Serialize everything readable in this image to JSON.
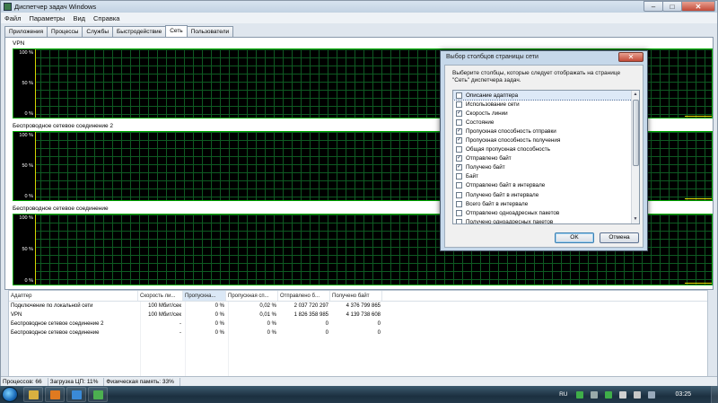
{
  "window": {
    "title": "Диспетчер задач Windows",
    "controls": {
      "minimize": "–",
      "maximize": "□",
      "close": "✕"
    }
  },
  "menu": [
    "Файл",
    "Параметры",
    "Вид",
    "Справка"
  ],
  "tabs": [
    "Приложения",
    "Процессы",
    "Службы",
    "Быстродействие",
    "Сеть",
    "Пользователи"
  ],
  "active_tab": "Сеть",
  "graphs": [
    {
      "label": "VPN",
      "y_top": "100 %",
      "y_mid": "50 %",
      "y_bottom": "0 %"
    },
    {
      "label": "Беспроводное сетевое соединение 2",
      "y_top": "100 %",
      "y_mid": "50 %",
      "y_bottom": "0 %"
    },
    {
      "label": "Беспроводное сетевое соединение",
      "y_top": "100 %",
      "y_mid": "50 %",
      "y_bottom": "0 %"
    }
  ],
  "adapter_table": {
    "columns": [
      "Адаптер",
      "Скорость ли...",
      "Пропускна...",
      "Пропускная сп...",
      "Отправлено б...",
      "Получено байт"
    ],
    "rows": [
      [
        "Подключение по локальной сети",
        "100 Мбит/сек",
        "0 %",
        "0,02 %",
        "2 037 720 297",
        "4 376 799 865"
      ],
      [
        "VPN",
        "100 Мбит/сек",
        "0 %",
        "0,01 %",
        "1 826 358 985",
        "4 139 738 608"
      ],
      [
        "Беспроводное сетевое соединение 2",
        "-",
        "0 %",
        "0 %",
        "0",
        "0"
      ],
      [
        "Беспроводное сетевое соединение",
        "-",
        "0 %",
        "0 %",
        "0",
        "0"
      ]
    ]
  },
  "statusbar": {
    "processes": "Процессов: 66",
    "cpu": "Загрузка ЦП: 11%",
    "memory": "Физическая память: 33%"
  },
  "dialog": {
    "title": "Выбор столбцов страницы сети",
    "close": "✕",
    "description": "Выберите столбцы, которые следует отображать на странице \"Сеть\" диспетчера задач.",
    "options": [
      {
        "label": "Описание адаптера",
        "checked": false,
        "selected": true
      },
      {
        "label": "Использование сети",
        "checked": false
      },
      {
        "label": "Скорость линии",
        "checked": true
      },
      {
        "label": "Состояние",
        "checked": false
      },
      {
        "label": "Пропускная способность отправки",
        "checked": true
      },
      {
        "label": "Пропускная способность получения",
        "checked": true
      },
      {
        "label": "Общая пропускная способность",
        "checked": false
      },
      {
        "label": "Отправлено байт",
        "checked": true
      },
      {
        "label": "Получено байт",
        "checked": true
      },
      {
        "label": "Байт",
        "checked": false
      },
      {
        "label": "Отправлено байт в интервале",
        "checked": false
      },
      {
        "label": "Получено байт в интервале",
        "checked": false
      },
      {
        "label": "Всего байт в интервале",
        "checked": false
      },
      {
        "label": "Отправлено одноадресных пакетов",
        "checked": false
      },
      {
        "label": "Получено одноадресных пакетов",
        "checked": false
      }
    ],
    "ok": "OK",
    "cancel": "Отмена"
  },
  "taskbar": {
    "apps": [
      {
        "name": "explorer-icon",
        "color": "#d8b040"
      },
      {
        "name": "media-player-icon",
        "color": "#e07a20"
      },
      {
        "name": "ie-icon",
        "color": "#3a8ad8"
      },
      {
        "name": "task-manager-icon",
        "color": "#4caf50"
      }
    ],
    "language": "RU",
    "clock": "03:25",
    "tray_icons": [
      "#3fae49",
      "#9aa",
      "#3fae49",
      "#d0d0d0",
      "#c8c8c8",
      "#9ab"
    ]
  },
  "colors": {
    "graph_bg": "#000000",
    "graph_grid": "#0e5a22",
    "graph_line": "#e8e800"
  }
}
